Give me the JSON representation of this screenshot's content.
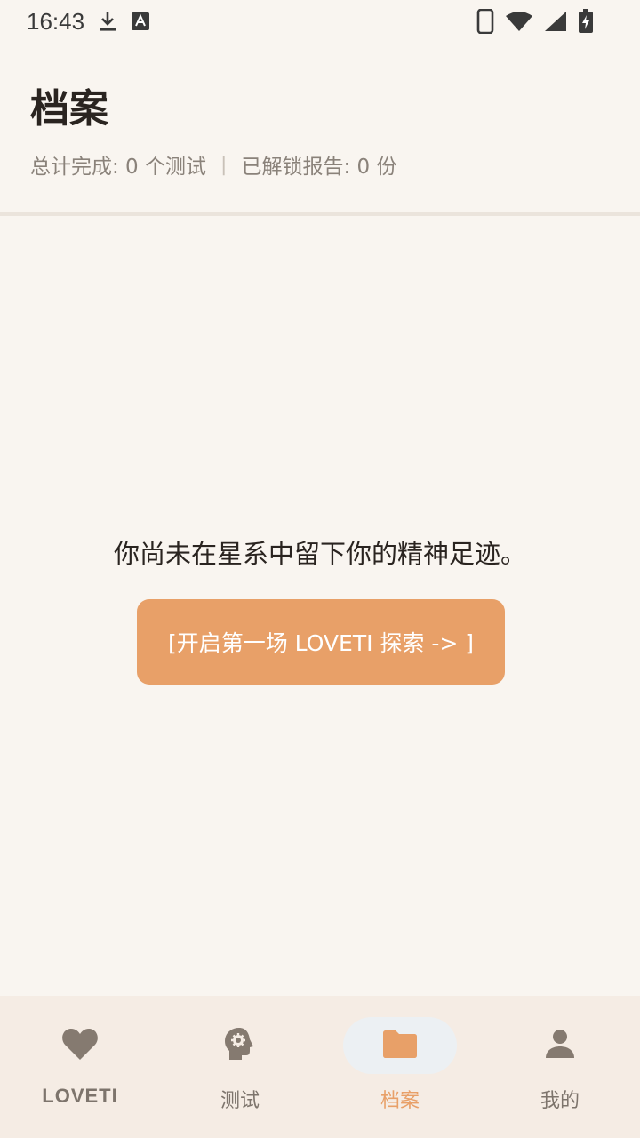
{
  "status_bar": {
    "time": "16:43",
    "left_icons": [
      "download-icon",
      "text-a-icon"
    ],
    "right_icons": [
      "phone-icon",
      "wifi-icon",
      "signal-icon",
      "battery-charging-icon"
    ]
  },
  "header": {
    "title": "档案",
    "completed_label": "总计完成: 0 个测试",
    "separator": "|",
    "unlocked_label": "已解锁报告: 0 份"
  },
  "empty_state": {
    "message": "你尚未在星系中留下你的精神足迹。",
    "button_label": "[开启第一场 LOVETI 探索 -> ]"
  },
  "bottom_nav": {
    "items": [
      {
        "label": "LOVETI",
        "icon": "heart-icon",
        "active": false
      },
      {
        "label": "测试",
        "icon": "head-gear-icon",
        "active": false
      },
      {
        "label": "档案",
        "icon": "folder-icon",
        "active": true
      },
      {
        "label": "我的",
        "icon": "person-icon",
        "active": false
      }
    ]
  },
  "colors": {
    "background": "#f9f5f0",
    "accent": "#e8a068",
    "nav_background": "#f5ece4",
    "text_primary": "#2a2420",
    "text_secondary": "#8a827a"
  }
}
